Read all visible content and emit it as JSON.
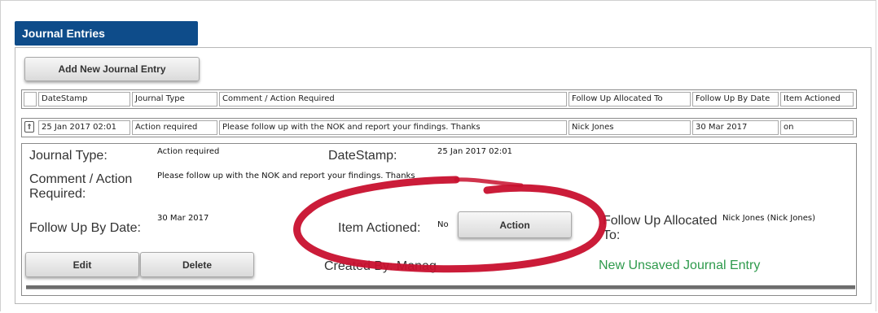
{
  "section": {
    "title": "Journal Entries"
  },
  "toolbar": {
    "add_label": "Add New Journal Entry"
  },
  "table": {
    "headers": [
      "DateStamp",
      "Journal Type",
      "Comment / Action Required",
      "Follow Up Allocated To",
      "Follow Up By Date",
      "Item Actioned"
    ],
    "rows": [
      {
        "cells": [
          "25 Jan 2017 02:01",
          "Action required",
          "Please follow up with the NOK and report your findings. Thanks",
          "Nick Jones",
          "30 Mar 2017",
          "on"
        ]
      }
    ],
    "collapse_icon": "double-chevron-up-icon",
    "collapse_glyph": "⇑"
  },
  "detail": {
    "journal_type_label": "Journal Type:",
    "journal_type_value": "Action required",
    "datestamp_label": "DateStamp:",
    "datestamp_value": "25 Jan 2017 02:01",
    "comment_label": "Comment / Action Required:",
    "comment_value": "Please follow up with the NOK and report your findings. Thanks",
    "followup_date_label": "Follow Up By Date:",
    "followup_date_value": "30 Mar 2017",
    "item_actioned_label": "Item Actioned:",
    "item_actioned_value": "No",
    "action_button": "Action",
    "allocated_label": "Follow Up Allocated To:",
    "allocated_value": "Nick Jones (Nick Jones)",
    "created_by_label": "Created By: Manag",
    "status": "New Unsaved Journal Entry",
    "edit_button": "Edit",
    "delete_button": "Delete"
  },
  "colors": {
    "header_tab": "#0e4c8a",
    "status_green": "#2e9a4c",
    "annotation_red": "#d0152a"
  }
}
